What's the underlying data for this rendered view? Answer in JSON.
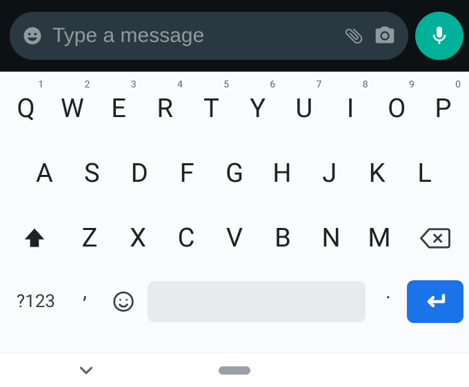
{
  "inputBar": {
    "placeholder": "Type a message"
  },
  "keyboard": {
    "row1": [
      {
        "letter": "Q",
        "sup": "1"
      },
      {
        "letter": "W",
        "sup": "2"
      },
      {
        "letter": "E",
        "sup": "3"
      },
      {
        "letter": "R",
        "sup": "4"
      },
      {
        "letter": "T",
        "sup": "5"
      },
      {
        "letter": "Y",
        "sup": "6"
      },
      {
        "letter": "U",
        "sup": "7"
      },
      {
        "letter": "I",
        "sup": "8"
      },
      {
        "letter": "O",
        "sup": "9"
      },
      {
        "letter": "P",
        "sup": "0"
      }
    ],
    "row2": [
      {
        "letter": "A"
      },
      {
        "letter": "S"
      },
      {
        "letter": "D"
      },
      {
        "letter": "F"
      },
      {
        "letter": "G"
      },
      {
        "letter": "H"
      },
      {
        "letter": "J"
      },
      {
        "letter": "K"
      },
      {
        "letter": "L"
      }
    ],
    "row3": [
      {
        "letter": "Z"
      },
      {
        "letter": "X"
      },
      {
        "letter": "C"
      },
      {
        "letter": "V"
      },
      {
        "letter": "B"
      },
      {
        "letter": "N"
      },
      {
        "letter": "M"
      }
    ],
    "symbols": "?123",
    "comma": ",",
    "period": "."
  }
}
